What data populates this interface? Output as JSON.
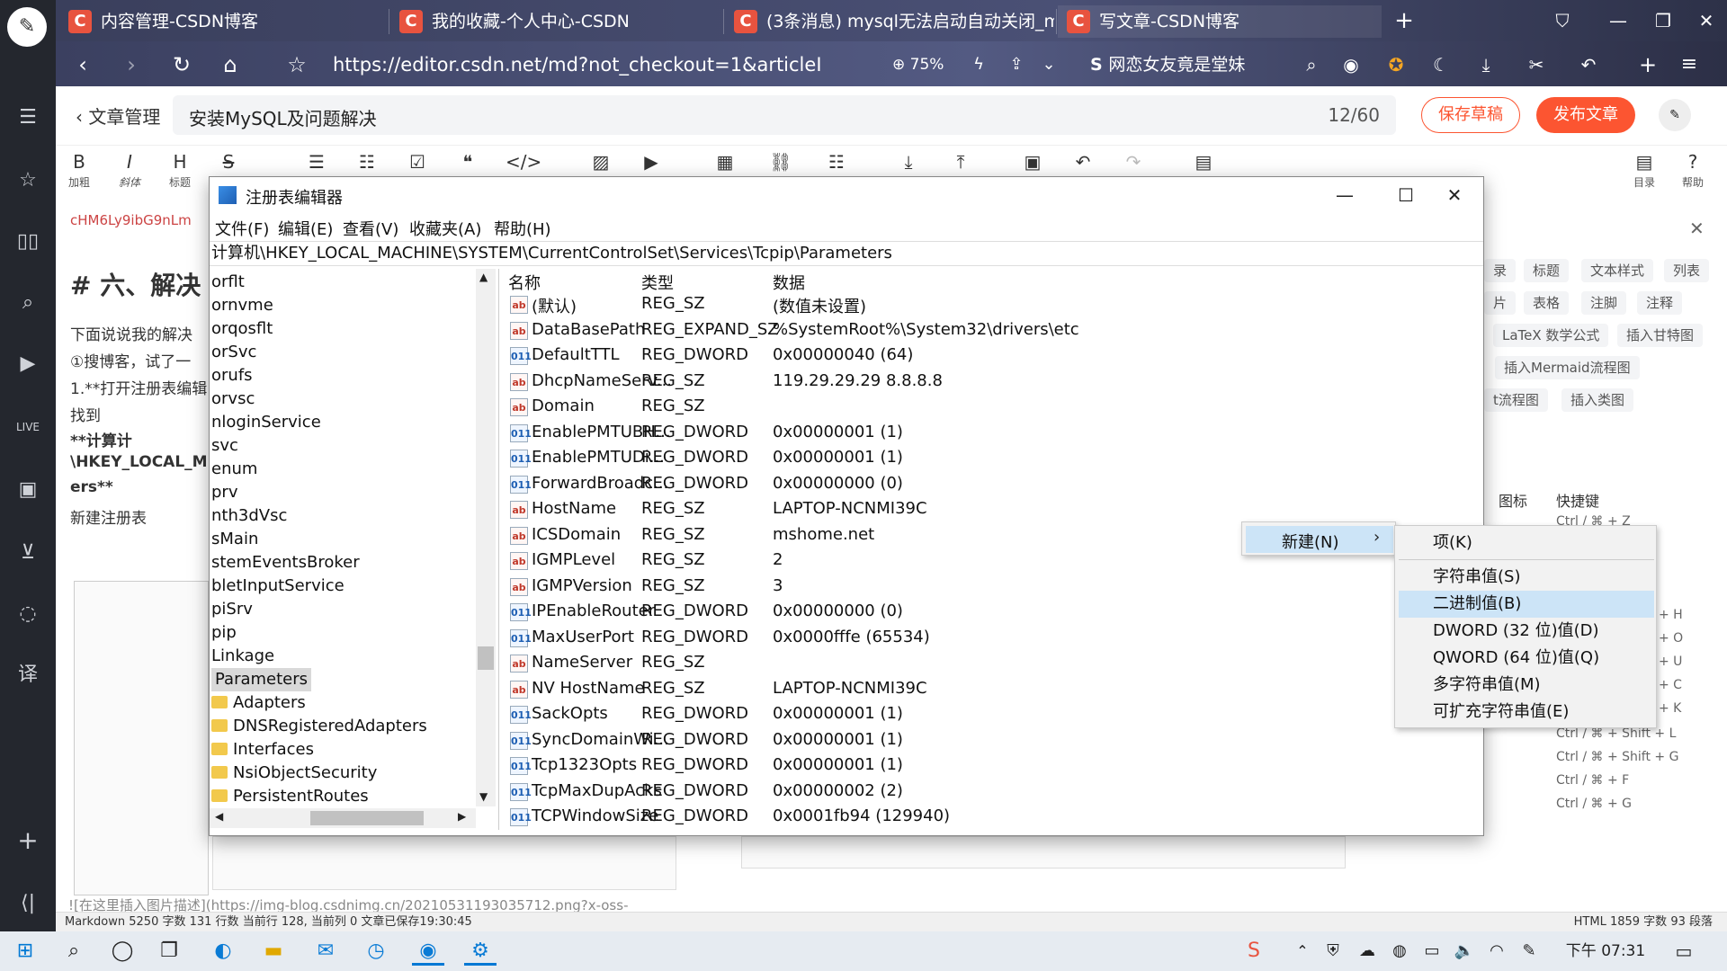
{
  "browser": {
    "tabs": [
      {
        "label": "内容管理-CSDN博客",
        "icon": "C"
      },
      {
        "label": "我的收藏-个人中心-CSDN",
        "icon": "C"
      },
      {
        "label": "(3条消息) mysql无法启动自动关闭_m",
        "icon": "C"
      },
      {
        "label": "写文章-CSDN博客",
        "icon": "C"
      }
    ],
    "url": "https://editor.csdn.net/md?not_checkout=1&articleI",
    "zoom": "75%",
    "search_text": "网恋女友竟是堂妹"
  },
  "editor": {
    "back_label": "文章管理",
    "title": "安装MySQL及问题解决",
    "title_count": "12/60",
    "save_label": "保存草稿",
    "publish_label": "发布文章",
    "toolbar": [
      {
        "glyph": "B",
        "label": "加粗"
      },
      {
        "glyph": "I",
        "label": "斜体"
      },
      {
        "glyph": "H",
        "label": "标题"
      },
      {
        "glyph": "S",
        "label": ""
      }
    ],
    "toolbar_right": [
      {
        "label": "目录"
      },
      {
        "label": "帮助"
      }
    ],
    "content_lines": [
      "cHM6Ly9ibG9nLm",
      "# 六、解决",
      "下面说说我的解决",
      "①搜博客，试了一",
      "1.**打开注册表编辑",
      "找到",
      "**计算计",
      "\\HKEY_LOCAL_M",
      "ers**",
      "新建注册表"
    ],
    "preview_chips": [
      [
        "录",
        "标题",
        "文本样式",
        "列表"
      ],
      [
        "片",
        "表格",
        "注脚",
        "注释"
      ],
      [
        "LaTeX 数学公式",
        "插入甘特图"
      ],
      [
        "插入Mermaid流程图"
      ],
      [
        "t流程图",
        "插入类图"
      ]
    ],
    "shortcut_headers": {
      "icon": "图标",
      "shortcut": "快捷键"
    },
    "shortcuts": [
      "Ctrl / ⌘ + Z",
      "+ H",
      "+ O",
      "+ U",
      "+ C",
      "+ K",
      "Ctrl / ⌘ + Shift + L",
      "Ctrl / ⌘ + Shift + G",
      "Ctrl / ⌘ + F",
      "Ctrl / ⌘ + G"
    ],
    "image_link": "![在这里插入图片描述](https://img-blog.csdnimg.cn/20210531193035712.png?x-oss-",
    "status_left": "Markdown  5250 字数  131 行数  当前行 128, 当前列 0  文章已保存19:30:45",
    "status_right": "HTML  1859 字数  93 段落"
  },
  "regedit": {
    "title": "注册表编辑器",
    "menu": [
      "文件(F)",
      "编辑(E)",
      "查看(V)",
      "收藏夹(A)",
      "帮助(H)"
    ],
    "path": "计算机\\HKEY_LOCAL_MACHINE\\SYSTEM\\CurrentControlSet\\Services\\Tcpip\\Parameters",
    "tree": [
      {
        "label": "orflt",
        "folder": false
      },
      {
        "label": "ornvme",
        "folder": false
      },
      {
        "label": "orqosflt",
        "folder": false
      },
      {
        "label": "orSvc",
        "folder": false
      },
      {
        "label": "orufs",
        "folder": false
      },
      {
        "label": "orvsc",
        "folder": false
      },
      {
        "label": "nloginService",
        "folder": false
      },
      {
        "label": "svc",
        "folder": false
      },
      {
        "label": "enum",
        "folder": false
      },
      {
        "label": "prv",
        "folder": false
      },
      {
        "label": "nth3dVsc",
        "folder": false
      },
      {
        "label": "sMain",
        "folder": false
      },
      {
        "label": "stemEventsBroker",
        "folder": false
      },
      {
        "label": "bletInputService",
        "folder": false
      },
      {
        "label": "piSrv",
        "folder": false
      },
      {
        "label": "pip",
        "folder": false
      },
      {
        "label": "Linkage",
        "folder": false
      },
      {
        "label": "Parameters",
        "folder": false,
        "selected": true
      },
      {
        "label": "Adapters",
        "folder": true
      },
      {
        "label": "DNSRegisteredAdapters",
        "folder": true
      },
      {
        "label": "Interfaces",
        "folder": true
      },
      {
        "label": "NsiObjectSecurity",
        "folder": true
      },
      {
        "label": "PersistentRoutes",
        "folder": true
      }
    ],
    "columns": [
      "名称",
      "类型",
      "数据"
    ],
    "values": [
      {
        "name": "(默认)",
        "type": "REG_SZ",
        "data": "(数值未设置)",
        "kind": "sz"
      },
      {
        "name": "DataBasePath",
        "type": "REG_EXPAND_SZ",
        "data": "%SystemRoot%\\System32\\drivers\\etc",
        "kind": "sz"
      },
      {
        "name": "DefaultTTL",
        "type": "REG_DWORD",
        "data": "0x00000040 (64)",
        "kind": "bin"
      },
      {
        "name": "DhcpNameServ...",
        "type": "REG_SZ",
        "data": "119.29.29.29 8.8.8.8",
        "kind": "sz"
      },
      {
        "name": "Domain",
        "type": "REG_SZ",
        "data": "",
        "kind": "sz"
      },
      {
        "name": "EnablePMTUBH...",
        "type": "REG_DWORD",
        "data": "0x00000001 (1)",
        "kind": "bin"
      },
      {
        "name": "EnablePMTUDi...",
        "type": "REG_DWORD",
        "data": "0x00000001 (1)",
        "kind": "bin"
      },
      {
        "name": "ForwardBroadc...",
        "type": "REG_DWORD",
        "data": "0x00000000 (0)",
        "kind": "bin"
      },
      {
        "name": "HostName",
        "type": "REG_SZ",
        "data": "LAPTOP-NCNMI39C",
        "kind": "sz"
      },
      {
        "name": "ICSDomain",
        "type": "REG_SZ",
        "data": "mshome.net",
        "kind": "sz"
      },
      {
        "name": "IGMPLevel",
        "type": "REG_SZ",
        "data": "2",
        "kind": "sz"
      },
      {
        "name": "IGMPVersion",
        "type": "REG_SZ",
        "data": "3",
        "kind": "sz"
      },
      {
        "name": "IPEnableRouter",
        "type": "REG_DWORD",
        "data": "0x00000000 (0)",
        "kind": "bin"
      },
      {
        "name": "MaxUserPort",
        "type": "REG_DWORD",
        "data": "0x0000fffe (65534)",
        "kind": "bin"
      },
      {
        "name": "NameServer",
        "type": "REG_SZ",
        "data": "",
        "kind": "sz"
      },
      {
        "name": "NV HostName",
        "type": "REG_SZ",
        "data": "LAPTOP-NCNMI39C",
        "kind": "sz"
      },
      {
        "name": "SackOpts",
        "type": "REG_DWORD",
        "data": "0x00000001 (1)",
        "kind": "bin"
      },
      {
        "name": "SyncDomainWi...",
        "type": "REG_DWORD",
        "data": "0x00000001 (1)",
        "kind": "bin"
      },
      {
        "name": "Tcp1323Opts",
        "type": "REG_DWORD",
        "data": "0x00000001 (1)",
        "kind": "bin"
      },
      {
        "name": "TcpMaxDupAcks",
        "type": "REG_DWORD",
        "data": "0x00000002 (2)",
        "kind": "bin"
      },
      {
        "name": "TCPWindowSize",
        "type": "REG_DWORD",
        "data": "0x0001fb94 (129940)",
        "kind": "bin"
      }
    ],
    "context_menu": {
      "new_label": "新建(N)",
      "submenu": [
        {
          "label": "项(K)"
        },
        {
          "label": "字符串值(S)"
        },
        {
          "label": "二进制值(B)",
          "highlighted": true
        },
        {
          "label": "DWORD (32 位)值(D)"
        },
        {
          "label": "QWORD (64 位)值(Q)"
        },
        {
          "label": "多字符串值(M)"
        },
        {
          "label": "可扩充字符串值(E)"
        }
      ]
    }
  },
  "taskbar": {
    "time": "下午 07:31"
  },
  "colors": {
    "csdn_red": "#fc5531",
    "menu_highlight": "#cce4f7"
  }
}
